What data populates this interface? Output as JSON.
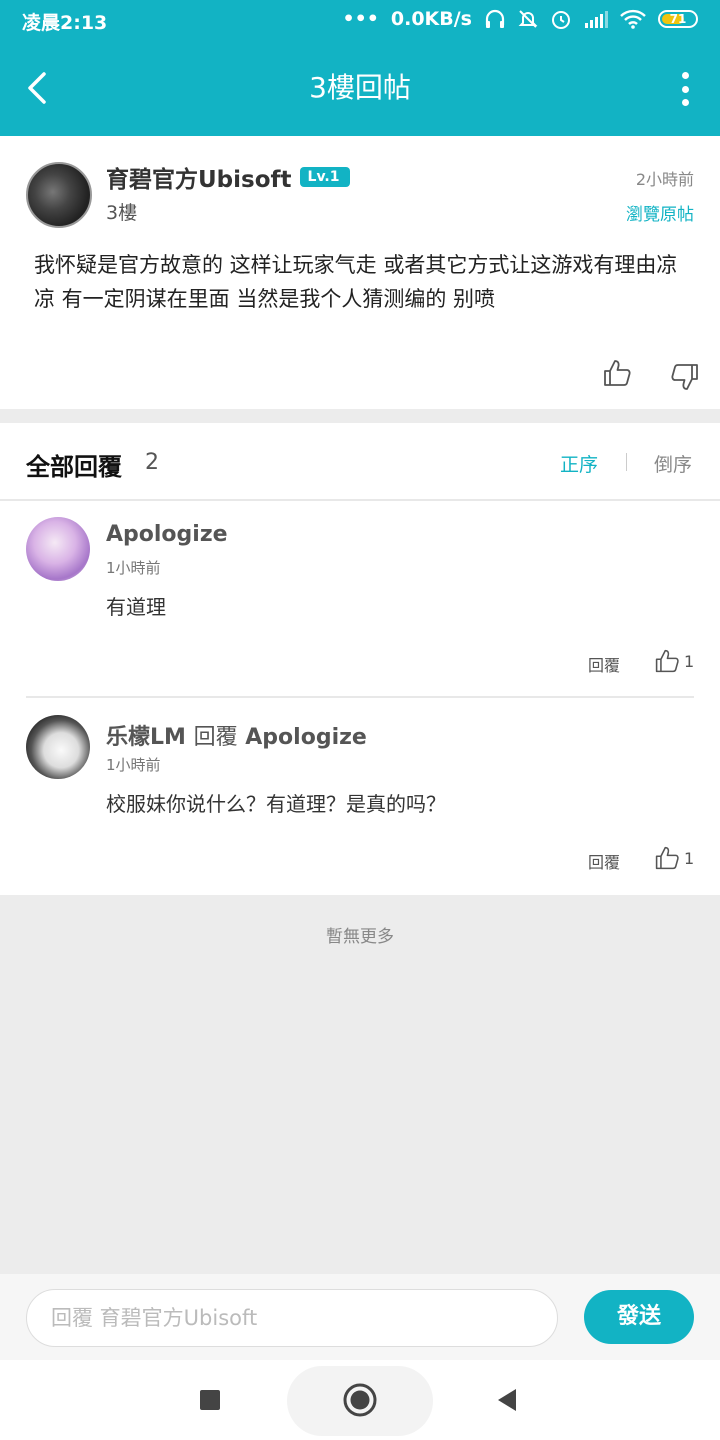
{
  "status_bar": {
    "time": "凌晨2:13",
    "network_speed": "0.0KB/s",
    "battery": "71",
    "icons": [
      "more-dots-icon",
      "headphones-icon",
      "mute-bell-icon",
      "alarm-icon",
      "signal-icon",
      "wifi-icon",
      "battery-icon"
    ]
  },
  "header": {
    "title": "3樓回帖",
    "back_icon": "back-arrow-icon",
    "menu_icon": "more-vertical-icon"
  },
  "post": {
    "author": "育碧官方Ubisoft",
    "level": "Lv.1",
    "floor": "3樓",
    "time": "2小時前",
    "view_original": "瀏覽原帖",
    "content": "我怀疑是官方故意的  这样让玩家气走 或者其它方式让这游戏有理由凉凉 有一定阴谋在里面 当然是我个人猜测编的 别喷"
  },
  "replies_section": {
    "heading": "全部回覆",
    "count": "2",
    "order_asc": "正序",
    "order_desc": "倒序",
    "items": [
      {
        "author": "Apologize",
        "reply_word": "",
        "reply_to": "",
        "time": "1小時前",
        "text": "有道理",
        "reply_label": "回覆",
        "likes": "1"
      },
      {
        "author": "乐檬LM",
        "reply_word": "回覆",
        "reply_to": "Apologize",
        "time": "1小時前",
        "text": "校服妹你说什么？有道理？是真的吗？",
        "reply_label": "回覆",
        "likes": "1"
      }
    ],
    "no_more": "暫無更多"
  },
  "composer": {
    "placeholder": "回覆 育碧官方Ubisoft",
    "send_label": "發送"
  },
  "colors": {
    "accent": "#12b3c4",
    "background": "#ececec"
  }
}
